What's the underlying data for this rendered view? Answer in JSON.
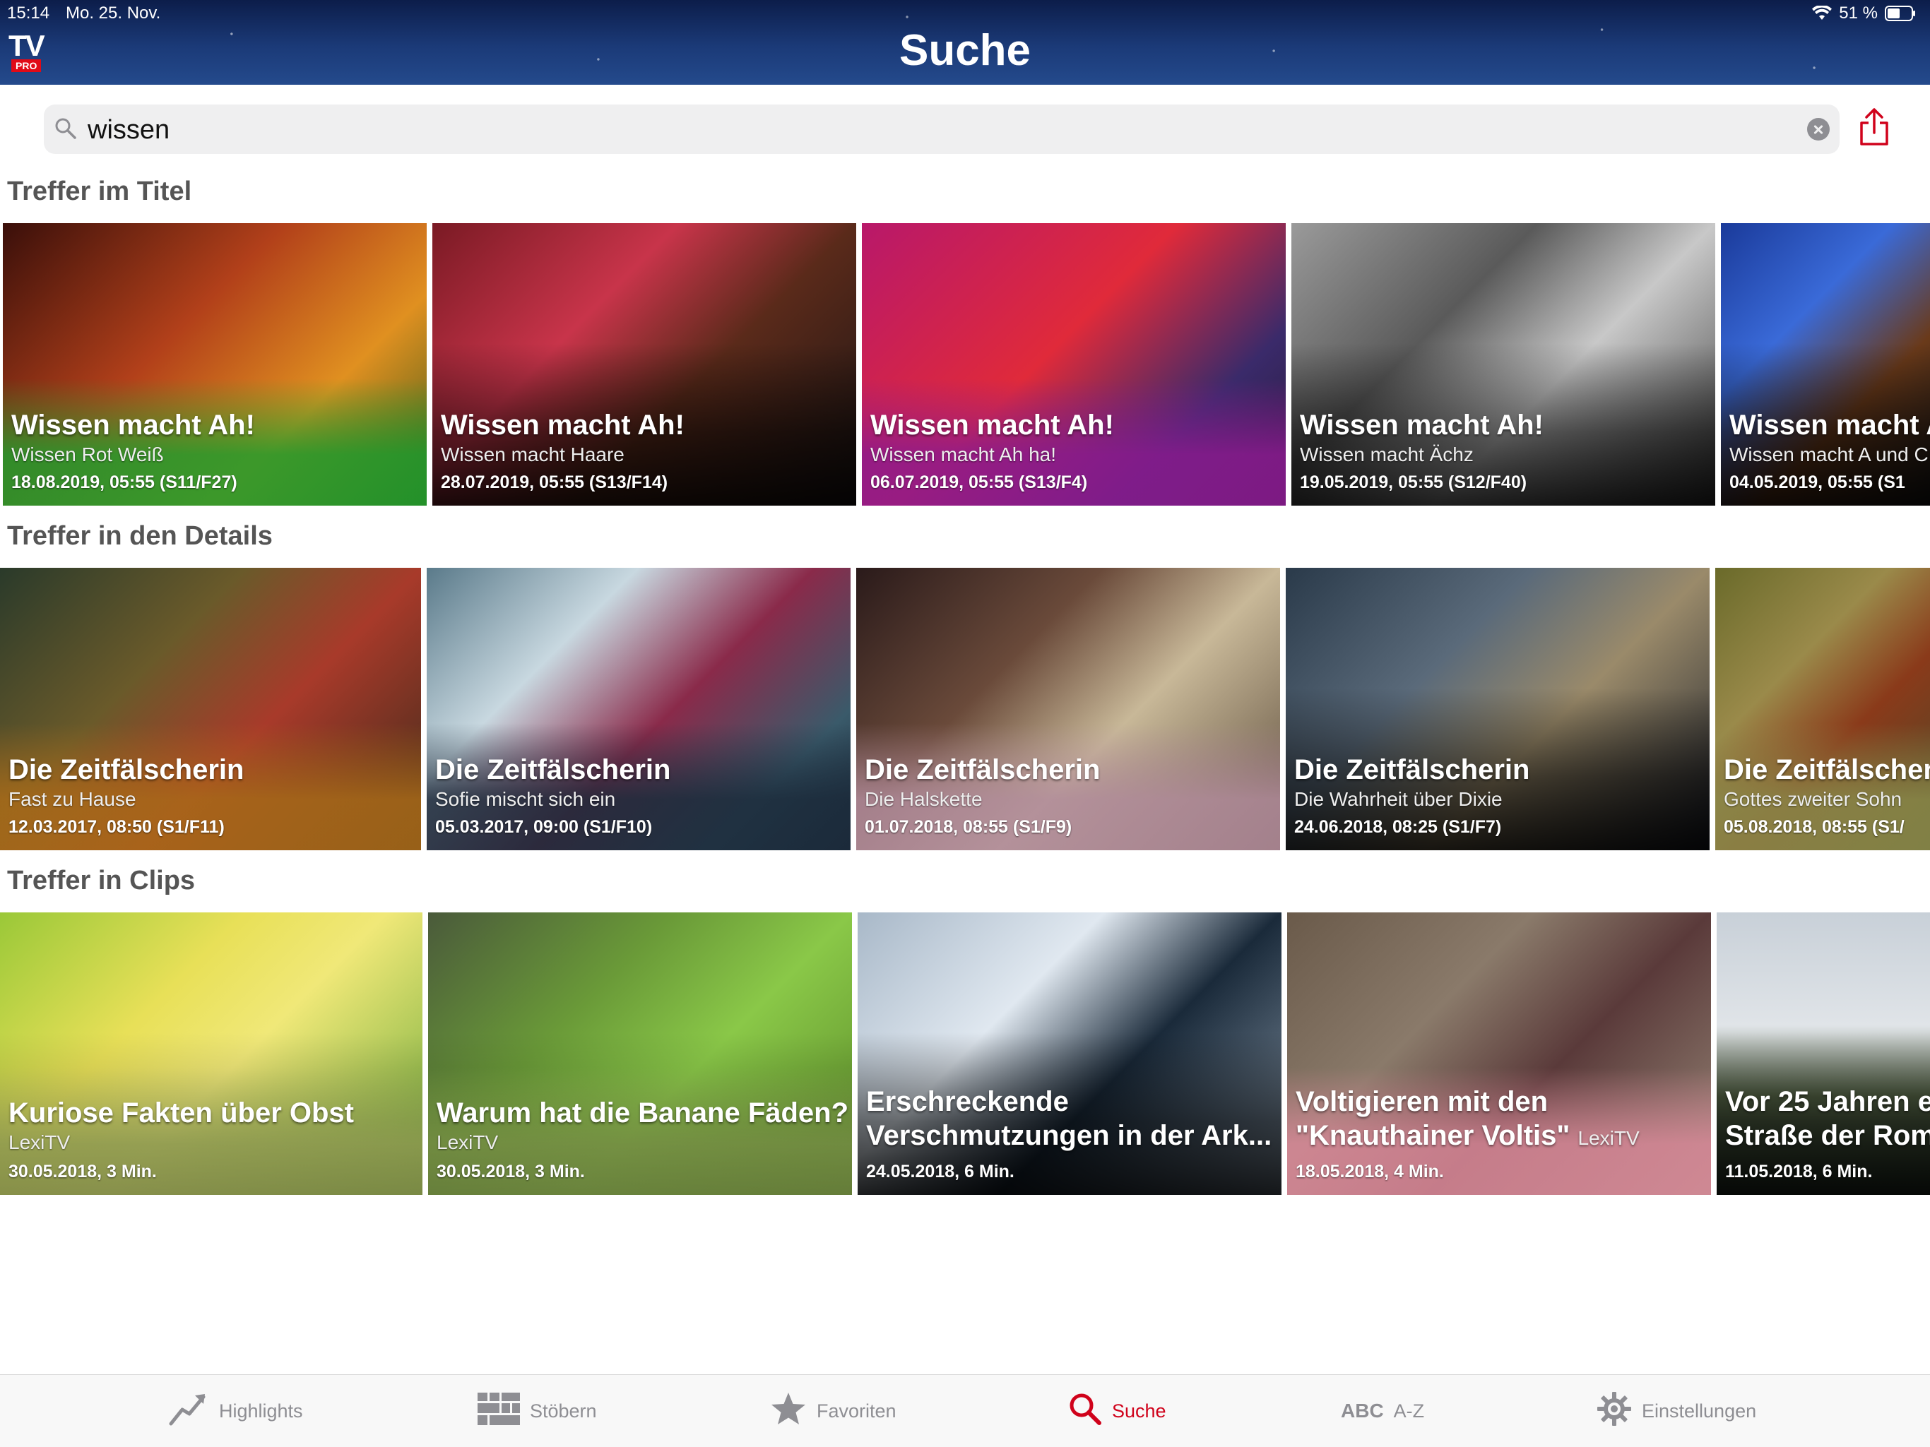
{
  "status_bar": {
    "time": "15:14",
    "date": "Mo. 25. Nov.",
    "battery": "51 %"
  },
  "header": {
    "logo_tv": "TV",
    "logo_pro": "PRO",
    "title": "Suche"
  },
  "search": {
    "value": "wissen"
  },
  "sections": {
    "titles": {
      "heading": "Treffer im Titel",
      "cards": [
        {
          "title": "Wissen macht Ah!",
          "subtitle": "Wissen Rot Weiß",
          "meta": "18.08.2019, 05:55 (S11/F27)",
          "tint": "#1f9a2c"
        },
        {
          "title": "Wissen macht Ah!",
          "subtitle": "Wissen macht Haare",
          "meta": "28.07.2019, 05:55 (S13/F14)",
          "tint": "#222222"
        },
        {
          "title": "Wissen macht Ah!",
          "subtitle": "Wissen macht Ah ha!",
          "meta": "06.07.2019, 05:55 (S13/F4)",
          "tint": "#8b1a8f"
        },
        {
          "title": "Wissen macht Ah!",
          "subtitle": "Wissen macht Ächz",
          "meta": "19.05.2019, 05:55 (S12/F40)",
          "tint": "#2b2b2b"
        },
        {
          "title": "Wissen macht A",
          "subtitle": "Wissen macht A und C",
          "meta": "04.05.2019, 05:55 (S1",
          "tint": "#1d1d1d"
        }
      ]
    },
    "details": {
      "heading": "Treffer in den Details",
      "cards": [
        {
          "title": "Die Zeitfälscherin",
          "subtitle": "Fast zu Hause",
          "meta": "12.03.2017, 08:50 (S1/F11)",
          "tint": "#a86a18"
        },
        {
          "title": "Die Zeitfälscherin",
          "subtitle": "Sofie mischt sich ein",
          "meta": "05.03.2017, 09:00 (S1/F10)",
          "tint": "#1b2a3a"
        },
        {
          "title": "Die Zeitfälscherin",
          "subtitle": "Die Halskette",
          "meta": "01.07.2018, 08:55 (S1/F9)",
          "tint": "#b08a9a"
        },
        {
          "title": "Die Zeitfälscherin",
          "subtitle": "Die Wahrheit über Dixie",
          "meta": "24.06.2018, 08:25 (S1/F7)",
          "tint": "#1a1e28"
        },
        {
          "title": "Die Zeitfälscher",
          "subtitle": "Gottes zweiter Sohn",
          "meta": "05.08.2018, 08:55 (S1/",
          "tint": "#8a8a4a"
        }
      ]
    },
    "clips": {
      "heading": "Treffer in Clips",
      "cards": [
        {
          "title": "Kuriose Fakten über Obst",
          "title2": "",
          "source": "LexiTV",
          "meta": "30.05.2018, 3 Min.",
          "tint": "#c8d878"
        },
        {
          "title": "Warum hat die Banane Fäden?",
          "title2": "",
          "source": "LexiTV",
          "meta": "30.05.2018, 3 Min.",
          "tint": "#a8c858"
        },
        {
          "title": "Erschreckende",
          "title2": "Verschmutzungen in der Ark...",
          "source": "",
          "meta": "24.05.2018, 6 Min.",
          "tint": "#5a6478"
        },
        {
          "title": "Voltigieren mit den",
          "title2": "\"Knauthainer Voltis\"",
          "source": "LexiTV",
          "meta": "18.05.2018, 4 Min.",
          "tint": "#d88898"
        },
        {
          "title": "Vor 25 Jahren e",
          "title2": "Straße der Rom",
          "source": "",
          "meta": "11.05.2018, 6 Min.",
          "tint": "#1e2430"
        }
      ]
    }
  },
  "tabbar": {
    "items": [
      {
        "label": "Highlights",
        "icon": "trend-icon"
      },
      {
        "label": "Stöbern",
        "icon": "grid-icon"
      },
      {
        "label": "Favoriten",
        "icon": "star-icon"
      },
      {
        "label": "Suche",
        "icon": "search-icon"
      },
      {
        "label": "A-Z",
        "prefix": "ABC",
        "icon": "abc-icon"
      },
      {
        "label": "Einstellungen",
        "icon": "gear-icon"
      }
    ],
    "active_color": "#d0021b"
  }
}
